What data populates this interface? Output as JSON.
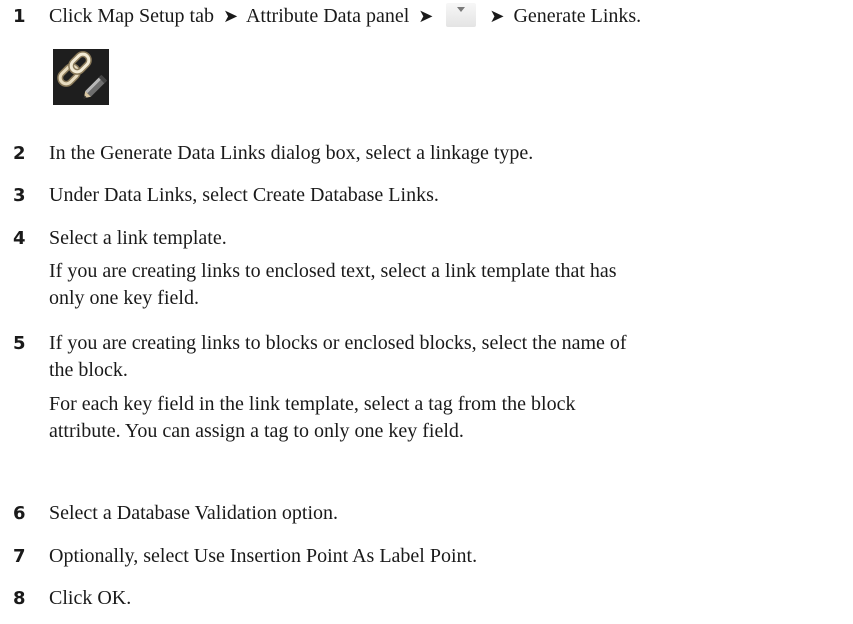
{
  "steps": [
    {
      "num": "1",
      "parts": [
        "Click Map Setup tab",
        "Attribute Data panel",
        "Generate Links."
      ],
      "icons": [
        "dropdown-arrow-icon",
        "generate-links-icon"
      ]
    },
    {
      "num": "2",
      "text": "In the Generate Data Links dialog box, select a linkage type."
    },
    {
      "num": "3",
      "text": "Under Data Links, select Create Database Links."
    },
    {
      "num": "4",
      "text": "Select a link template.",
      "note_lines": [
        "If you are creating links to enclosed text, select a link template that has",
        "only one key field."
      ]
    },
    {
      "num": "5",
      "lines": [
        "If you are creating links to blocks or enclosed blocks, select the name of",
        "the block."
      ],
      "note_lines": [
        "For each key field in the link template, select a tag from the block",
        "attribute. You can assign a tag to only one key field."
      ]
    },
    {
      "num": "6",
      "text": "Select a Database Validation option."
    },
    {
      "num": "7",
      "text": "Optionally, select Use Insertion Point As Label Point."
    },
    {
      "num": "8",
      "text": "Click OK."
    }
  ],
  "arrow_glyph": "➤"
}
